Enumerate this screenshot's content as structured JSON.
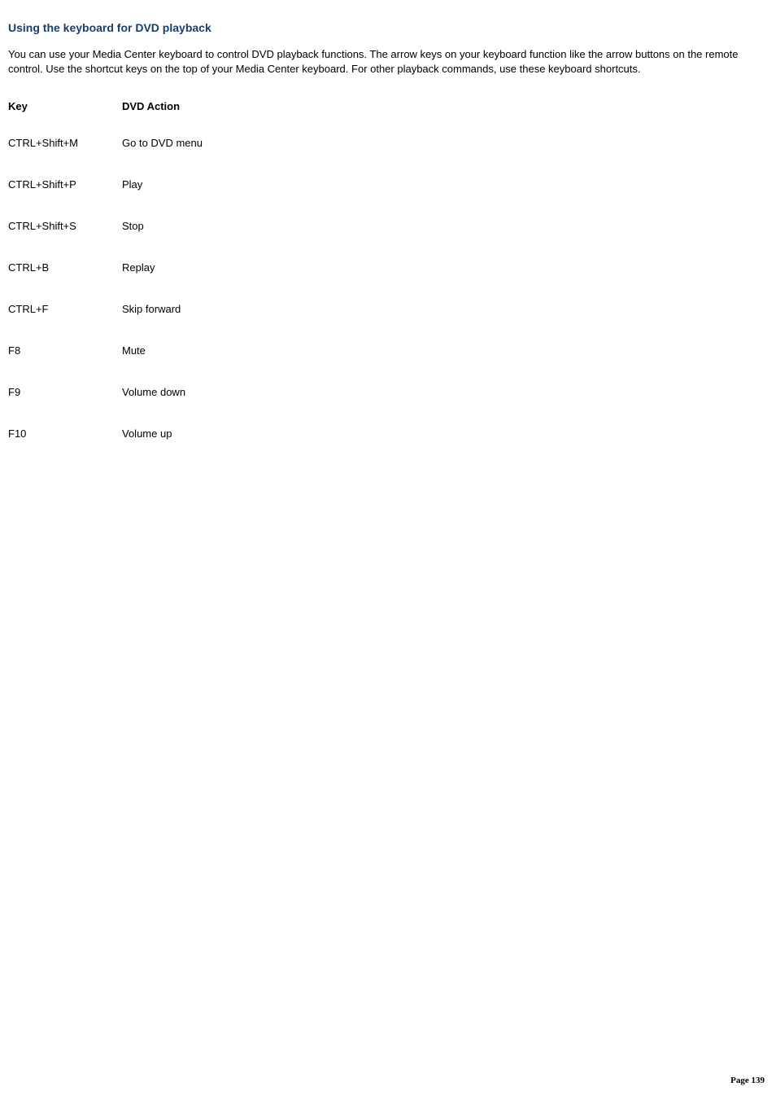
{
  "heading": "Using the keyboard for DVD playback",
  "intro": "You can use your Media Center keyboard to control DVD playback functions. The arrow keys on your keyboard function like the arrow buttons on the remote control. Use the shortcut keys on the top of your Media Center keyboard. For other playback commands, use these keyboard shortcuts.",
  "table": {
    "headers": {
      "key": "Key",
      "action": "DVD Action"
    },
    "rows": [
      {
        "key": "CTRL+Shift+M",
        "action": "Go to DVD menu"
      },
      {
        "key": "CTRL+Shift+P",
        "action": "Play"
      },
      {
        "key": "CTRL+Shift+S",
        "action": "Stop"
      },
      {
        "key": "CTRL+B",
        "action": "Replay"
      },
      {
        "key": "CTRL+F",
        "action": "Skip forward"
      },
      {
        "key": "F8",
        "action": "Mute"
      },
      {
        "key": "F9",
        "action": "Volume down"
      },
      {
        "key": "F10",
        "action": "Volume up"
      }
    ]
  },
  "page_number": "Page 139"
}
